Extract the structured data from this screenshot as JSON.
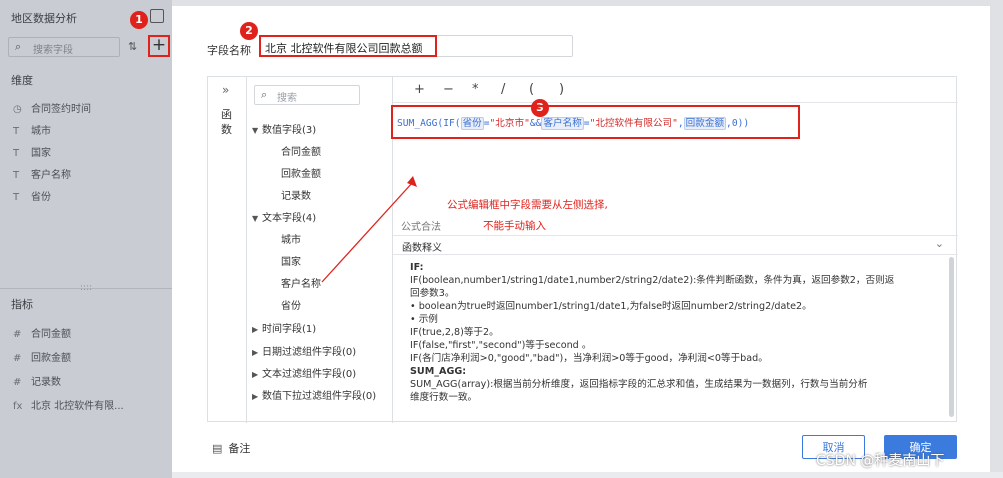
{
  "left_panel": {
    "title": "地区数据分析",
    "search_placeholder": "搜索字段",
    "plus_label": "+",
    "dimension_header": "维度",
    "dimensions": [
      {
        "icon": "◷",
        "label": "合同签约时间"
      },
      {
        "icon": "T",
        "label": "城市"
      },
      {
        "icon": "T",
        "label": "国家"
      },
      {
        "icon": "T",
        "label": "客户名称"
      },
      {
        "icon": "T",
        "label": "省份"
      }
    ],
    "metric_header": "指标",
    "metrics": [
      {
        "icon": "#",
        "label": "合同金额"
      },
      {
        "icon": "#",
        "label": "回款金额"
      },
      {
        "icon": "#",
        "label": "记录数"
      },
      {
        "icon": "fx",
        "label": "北京 北控软件有限..."
      }
    ]
  },
  "markers": [
    "1",
    "2",
    "3"
  ],
  "dialog": {
    "field_name_label": "字段名称",
    "field_name_value": "北京 北控软件有限公司回款总额",
    "collapse_label": "函数",
    "tree_search_placeholder": "搜索",
    "tree": [
      {
        "arrow": "▼",
        "label": "数值字段(3)",
        "level": 0
      },
      {
        "arrow": "",
        "label": "合同金额",
        "level": 1
      },
      {
        "arrow": "",
        "label": "回款金额",
        "level": 1
      },
      {
        "arrow": "",
        "label": "记录数",
        "level": 1
      },
      {
        "arrow": "▼",
        "label": "文本字段(4)",
        "level": 0
      },
      {
        "arrow": "",
        "label": "城市",
        "level": 1
      },
      {
        "arrow": "",
        "label": "国家",
        "level": 1
      },
      {
        "arrow": "",
        "label": "客户名称",
        "level": 1
      },
      {
        "arrow": "",
        "label": "省份",
        "level": 1
      },
      {
        "arrow": "▶",
        "label": "时间字段(1)",
        "level": 0
      },
      {
        "arrow": "▶",
        "label": "日期过滤组件字段(0)",
        "level": 0
      },
      {
        "arrow": "▶",
        "label": "文本过滤组件字段(0)",
        "level": 0
      },
      {
        "arrow": "▶",
        "label": "数值下拉过滤组件字段(0)",
        "level": 0
      }
    ],
    "operators": [
      "+",
      "−",
      "*",
      "/",
      "(",
      ")"
    ],
    "formula": {
      "p1": "SUM_AGG(IF(",
      "t1": "省份",
      "p2": "=",
      "s1": "\"北京市\"",
      "p3": "&&",
      "t2": "客户名称",
      "p4": "=",
      "s2": "\"北控软件有限公司\"",
      "p5": ",",
      "t3": "回款金额",
      "p6": ",0))"
    },
    "annotation_line1": "公式编辑框中字段需要从左侧选择,",
    "annotation_line2": "不能手动输入",
    "validity_text": "公式合法",
    "func_desc_header": "函数释义",
    "func_desc_lines": [
      "IF:",
      "IF(boolean,number1/string1/date1,number2/string2/date2):条件判断函数，条件为真，返回参数2，否则返",
      "回参数3。",
      "• boolean为true时返回number1/string1/date1,为false时返回number2/string2/date2。",
      "• 示例",
      "IF(true,2,8)等于2。",
      "IF(false,\"first\",\"second\")等于second 。",
      "IF(各门店净利润>0,\"good\",\"bad\")，当净利润>0等于good，净利润<0等于bad。",
      "SUM_AGG:",
      "SUM_AGG(array):根据当前分析维度，返回指标字段的汇总求和值，生成结果为一数据列，行数与当前分析",
      "维度行数一致。"
    ],
    "remark_label": "备注",
    "cancel_label": "取消",
    "ok_label": "确定"
  },
  "watermark": "CSDN @种麦南山下",
  "colors": {
    "marker_red": "#e0221c",
    "primary_blue": "#3b7bde",
    "formula_blue": "#3b6fd1"
  }
}
